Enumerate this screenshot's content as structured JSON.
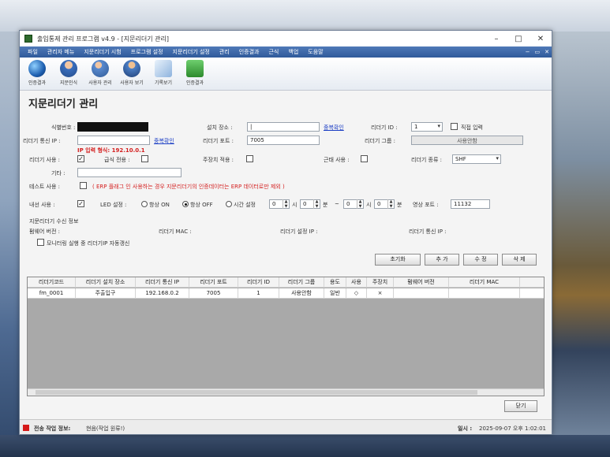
{
  "window": {
    "title": "출입통제 관리 프로그램 v4.9 - [지문리더기 관리]"
  },
  "menu": {
    "items": [
      "파일",
      "관리자 메뉴",
      "지문리더기 시험",
      "프로그램 설정",
      "지문리더기 설정",
      "관리",
      "인증결과",
      "근식",
      "백업",
      "도움말"
    ],
    "controls": [
      "−",
      "▭",
      "✕"
    ]
  },
  "toolbar": {
    "items": [
      {
        "label": "인증결과",
        "icon": "globe-icon"
      },
      {
        "label": "지문인식",
        "icon": "fingerprint-user-icon"
      },
      {
        "label": "사용자 관리",
        "icon": "users-icon"
      },
      {
        "label": "사용자 보기",
        "icon": "people-icon"
      },
      {
        "label": "기록보기",
        "icon": "checklist-icon"
      },
      {
        "label": "인증결과",
        "icon": "upload-icon"
      }
    ]
  },
  "form": {
    "heading": "지문리더기 관리",
    "id_label": "식별번호 :",
    "ip_label": "리더기 통신 IP :",
    "ip_value": "",
    "dup_check": "중복확인",
    "ip_hint": "IP 입력 형식: 192.10.0.1",
    "location_label": "설치 장소 :",
    "location_value": "|",
    "port_label": "리더기 포트 :",
    "port_value": "7005",
    "reader_id_label": "리더기 ID :",
    "reader_id_value": "1",
    "direct_input": "직접 입력",
    "group_label": "리더기 그룹 :",
    "group_value": "사용안함",
    "use_label": "리더기 사용 :",
    "meal_label": "급식 전용 :",
    "attendance_label": "주장치 적용 :",
    "work_use_label": "근태 사용 :",
    "type_label": "리더기 종류 :",
    "type_value": "SHF",
    "etc_label": "기타 :",
    "test_label": "테스트 사용 :",
    "test_note": "( ERP 플래그 인 사용하는 경우 지문리더기의 인증데이터는 ERP 데이터로만 제외 )",
    "sched_label": "내선 사용 :",
    "led_label": "LED 설정 :",
    "radio_always_on": "항상 ON",
    "radio_always_off": "항상 OFF",
    "radio_time": "시간 설정",
    "time_h1": "0",
    "time_sep1": "시",
    "time_m1": "0",
    "time_unit1": "분",
    "dash": "~",
    "time_h2": "0",
    "time_sep2": "시",
    "time_m2": "0",
    "time_unit2": "분",
    "video_port_label": "영상 포트 :",
    "video_port_value": "11132",
    "recv_title": "지문리더기 수신 정보",
    "fw_label": "펌웨어 버전 :",
    "mac_label": "리더기 MAC :",
    "setip_label": "리더기 설정 IP :",
    "commip_label": "리더기 통신 IP :",
    "monitor_chk": "모니터링 실행 중 리더기IP 자동갱신"
  },
  "buttons": {
    "clear": "초기화",
    "add": "추 가",
    "edit": "수 정",
    "delete": "삭 제",
    "close": "닫기"
  },
  "table": {
    "headers": [
      "리더기코드",
      "리더기 설치 장소",
      "리더기 통신 IP",
      "리더기 포트",
      "리더기 ID",
      "리더기 그룹",
      "용도",
      "사용",
      "주장치",
      "펌웨어 버전",
      "리더기 MAC"
    ],
    "rows": [
      [
        "fm_0001",
        "주출입구",
        "192.168.0.2",
        "7005",
        "1",
        "사용안함",
        "일반",
        "◇",
        "×",
        "",
        ""
      ]
    ]
  },
  "status": {
    "label": "전송 작업 정보:",
    "message": "현음(작업 원류!)",
    "time_label": "일시 :",
    "time_value": "2025-09-07 오후 1:02:01"
  }
}
